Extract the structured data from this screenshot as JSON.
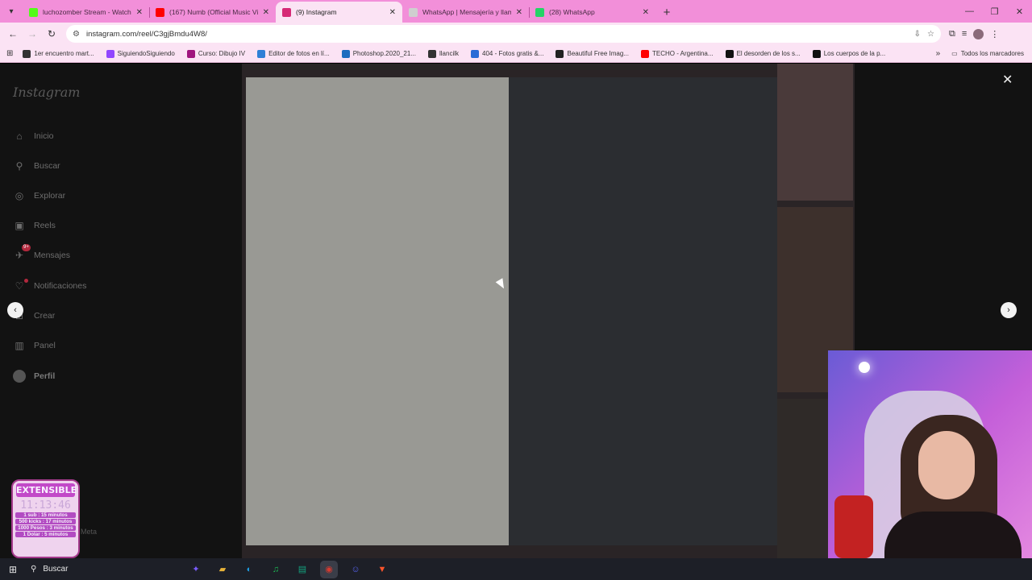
{
  "browser": {
    "tabs": [
      {
        "title": "luchozomber Stream - Watch L",
        "favicon_color": "#53fc18"
      },
      {
        "title": "(167) Numb (Official Music Vide",
        "favicon_color": "#ff0000"
      },
      {
        "title": "(9) Instagram",
        "favicon_color": "#d62976",
        "active": true
      },
      {
        "title": "WhatsApp | Mensajería y llama",
        "favicon_color": "#cfcfcf"
      },
      {
        "title": "(28) WhatsApp",
        "favicon_color": "#25d366"
      }
    ],
    "new_tab": "+",
    "url": "instagram.com/reel/C3gjBmdu4W8/",
    "bookmarks": [
      {
        "label": "1er encuentro mart...",
        "color": "#333333"
      },
      {
        "label": "SiguiendoSiguiendo",
        "color": "#9146ff"
      },
      {
        "label": "Curso: Dibujo IV",
        "color": "#a0157e"
      },
      {
        "label": "Editor de fotos en lí...",
        "color": "#2f7fd6"
      },
      {
        "label": "Photoshop.2020_21...",
        "color": "#1f6dbf"
      },
      {
        "label": "llancilk",
        "color": "#333333"
      },
      {
        "label": "404 - Fotos gratis &...",
        "color": "#2a6bd6"
      },
      {
        "label": "Beautiful Free Imag...",
        "color": "#222222"
      },
      {
        "label": "TECHO - Argentina...",
        "color": "#ff0000"
      },
      {
        "label": "El desorden de los s...",
        "color": "#111111"
      },
      {
        "label": "Los cuerpos de la p...",
        "color": "#111111"
      }
    ],
    "bookmarks_folder": "Todos los marcadores"
  },
  "instagram": {
    "logo": "Instagram",
    "nav": [
      {
        "label": "Inicio",
        "icon": "home-icon",
        "glyph": "⌂"
      },
      {
        "label": "Buscar",
        "icon": "search-icon",
        "glyph": "⚲"
      },
      {
        "label": "Explorar",
        "icon": "compass-icon",
        "glyph": "◎"
      },
      {
        "label": "Reels",
        "icon": "reels-icon",
        "glyph": "▣"
      },
      {
        "label": "Mensajes",
        "icon": "messenger-icon",
        "glyph": "✈",
        "badge": "9+"
      },
      {
        "label": "Notificaciones",
        "icon": "heart-icon",
        "glyph": "♡",
        "dot": true
      },
      {
        "label": "Crear",
        "icon": "create-icon",
        "glyph": "⊞"
      },
      {
        "label": "Panel",
        "icon": "dashboard-icon",
        "glyph": "▥"
      },
      {
        "label": "Perfil",
        "icon": "avatar",
        "glyph": ""
      }
    ],
    "footer_meta": "Meta",
    "close_glyph": "✕",
    "prev_glyph": "‹",
    "next_glyph": "›"
  },
  "overlay": {
    "timer_title": "EXTENSIBLE",
    "timer_time": "11:13:46",
    "timer_lines": [
      "1 sub : 15 minutos",
      "500 kicks : 17 minutos",
      "1000 Pesos : 3 minutos",
      "1 Dolar : 5 minutos"
    ]
  },
  "taskbar": {
    "search_label": "Buscar",
    "apps": [
      {
        "name": "copilot-icon",
        "color": "#7a5cff",
        "glyph": "✦"
      },
      {
        "name": "file-explorer-icon",
        "color": "#e8b339",
        "glyph": "▰"
      },
      {
        "name": "edge-icon",
        "color": "#1e9de0",
        "glyph": "◐"
      },
      {
        "name": "spotify-icon",
        "color": "#1db954",
        "glyph": "♫"
      },
      {
        "name": "app-icon",
        "color": "#14a37f",
        "glyph": "▤"
      },
      {
        "name": "chrome-icon",
        "color": "#d33a30",
        "glyph": "◉",
        "active": true
      },
      {
        "name": "discord-icon",
        "color": "#5865f2",
        "glyph": "☺"
      },
      {
        "name": "brave-icon",
        "color": "#fb542b",
        "glyph": "▼"
      }
    ]
  }
}
